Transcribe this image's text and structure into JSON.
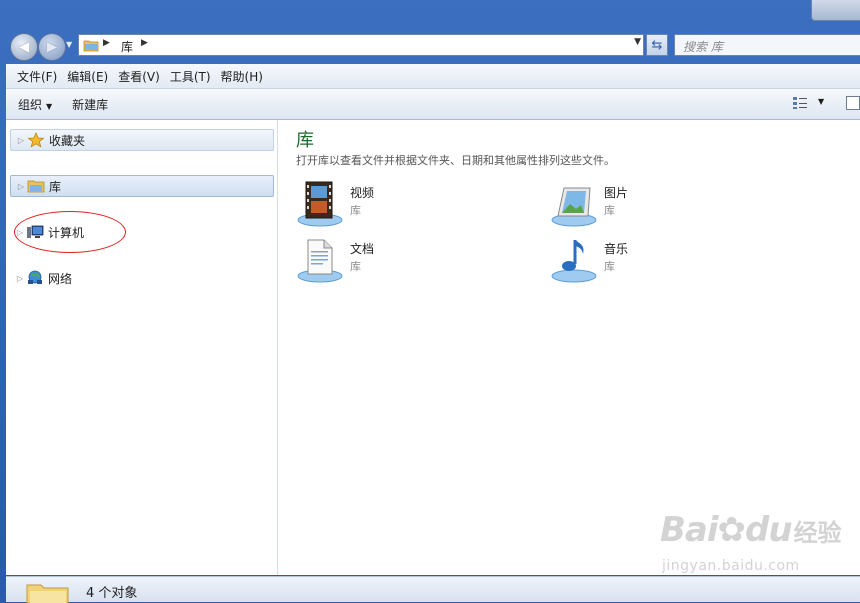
{
  "address_bar": {
    "crumb": "库",
    "search_placeholder": "搜索 库"
  },
  "menu": [
    "文件(F)",
    "编辑(E)",
    "查看(V)",
    "工具(T)",
    "帮助(H)"
  ],
  "toolbar": {
    "organize": "组织",
    "new_library": "新建库"
  },
  "nav_pane": {
    "favorites": "收藏夹",
    "libraries": "库",
    "computer": "计算机",
    "network": "网络"
  },
  "content": {
    "title": "库",
    "description": "打开库以查看文件并根据文件夹、日期和其他属性排列这些文件。",
    "libraries": [
      {
        "name": "视频",
        "type": "库",
        "icon": "video-library-icon"
      },
      {
        "name": "图片",
        "type": "库",
        "icon": "pictures-library-icon"
      },
      {
        "name": "文档",
        "type": "库",
        "icon": "documents-library-icon"
      },
      {
        "name": "音乐",
        "type": "库",
        "icon": "music-library-icon"
      }
    ]
  },
  "status": {
    "count_text": "4 个对象"
  },
  "watermark": {
    "logo": "Baidu经验",
    "url": "jingyan.baidu.com"
  },
  "colors": {
    "title_green": "#1e6a2a",
    "frame_blue": "#2f62b6",
    "annotation_red": "#dd2222"
  }
}
